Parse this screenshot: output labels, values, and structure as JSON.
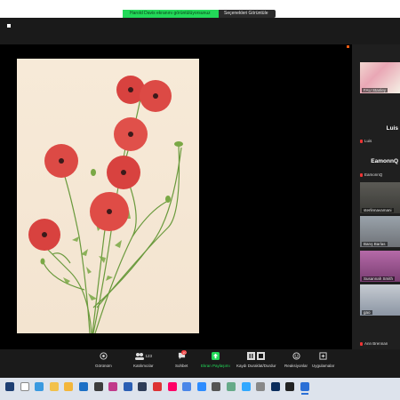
{
  "share_banner": {
    "status": "Harold Davis ekranını görüntülüyorsunuz",
    "view_options": "Seçenekleri Görüntüle"
  },
  "participants": [
    {
      "name": "FAU Stanley",
      "type": "video"
    },
    {
      "name": "Luis",
      "type": "text"
    },
    {
      "name": "Luis",
      "type": "label"
    },
    {
      "name": "EamonnQ",
      "type": "text"
    },
    {
      "name": "EamonnQ",
      "type": "label"
    },
    {
      "name": "sterlinnavamani",
      "type": "video"
    },
    {
      "name": "Barış Barlas",
      "type": "video"
    },
    {
      "name": "Susannah Smith",
      "type": "video"
    },
    {
      "name": "gao",
      "type": "video"
    },
    {
      "name": "Ann Brennan",
      "type": "label"
    }
  ],
  "toolbar": {
    "view": "Görünüm",
    "participants": "Katılımcılar",
    "participant_count": "123",
    "chat": "Sohbet",
    "chat_badge": "10",
    "share": "Ekran Paylaşımı",
    "record": "Kaydı Duraklat/Durdur",
    "reactions": "Reaksiyonlar",
    "apps": "Uygulamalar"
  },
  "colors": {
    "share_green": "#23d959",
    "zoom_bg": "#1a1a1a",
    "accent_orange": "#e95a12"
  },
  "taskbar": {
    "icons": [
      "start-icon",
      "search-icon",
      "edge-icon",
      "chrome-icon",
      "folder-icon",
      "mail-icon",
      "store-icon",
      "photos-icon",
      "word-icon",
      "lightroom-icon",
      "acrobat-icon",
      "flickr-icon",
      "browser-icon",
      "zoom-taskbar-icon",
      "calculator-icon",
      "gallery-icon",
      "bridge-icon",
      "settings-icon",
      "photoshop-icon",
      "terminal-icon",
      "active-app-icon"
    ]
  }
}
